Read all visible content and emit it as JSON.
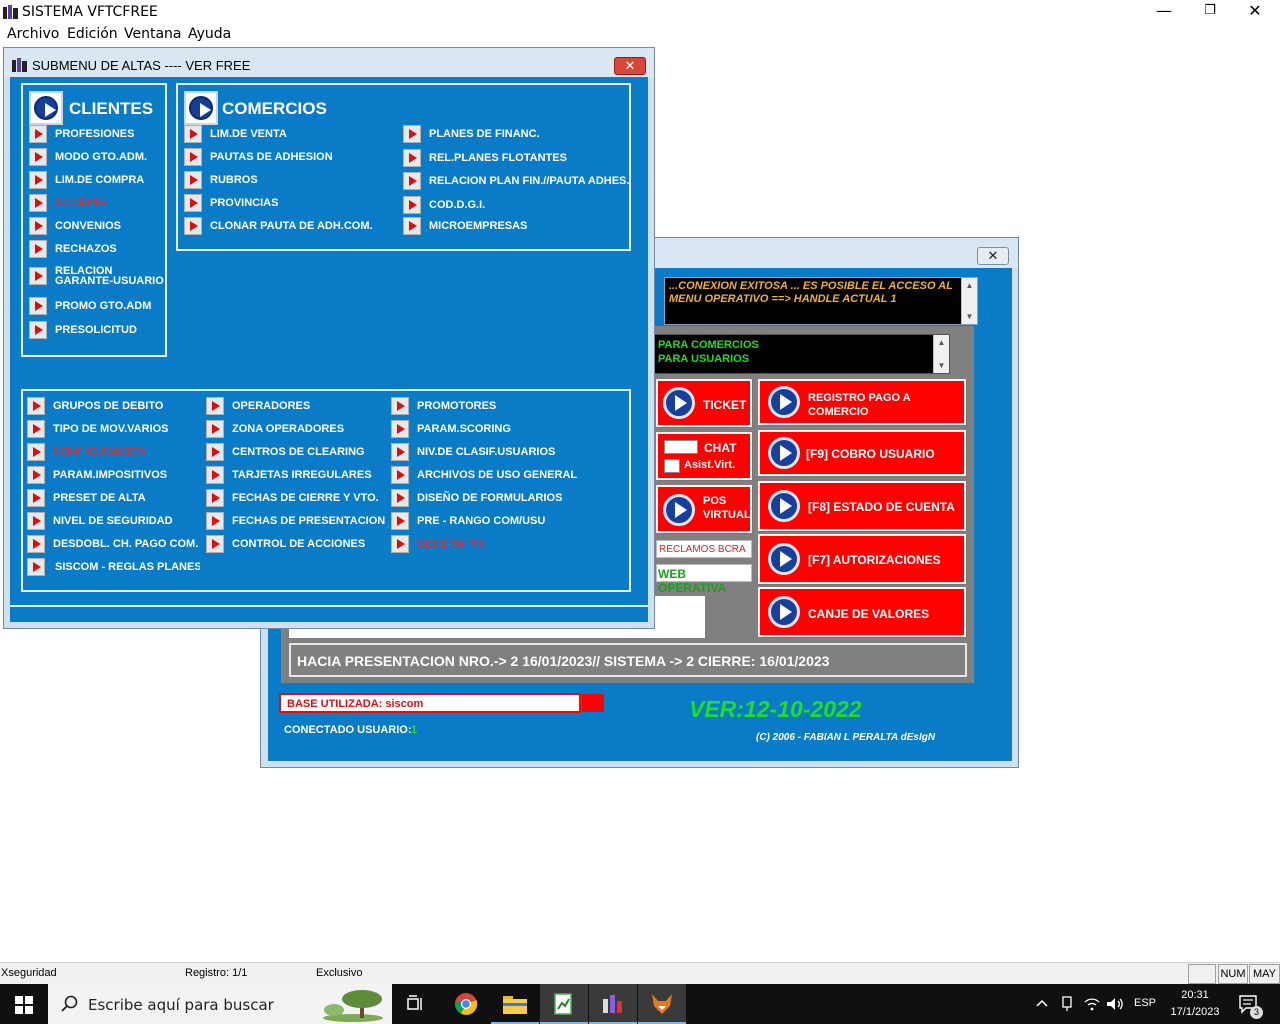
{
  "app": {
    "title": "SISTEMA VFTCFREE",
    "minimize": "—",
    "restore": "❐",
    "close": "✕"
  },
  "menubar": [
    "Archivo",
    "Edición",
    "Ventana",
    "Ayuda"
  ],
  "submenu_window": {
    "title": "SUBMENU DE ALTAS ---- VER FREE",
    "close": "✕",
    "clientes": {
      "title": "CLIENTES",
      "items": [
        {
          "label": "PROFESIONES",
          "highlight": false
        },
        {
          "label": "MODO GTO.ADM.",
          "highlight": false
        },
        {
          "label": "LIM.DE COMPRA",
          "highlight": false
        },
        {
          "label": "SCORING",
          "highlight": true
        },
        {
          "label": "CONVENIOS",
          "highlight": false
        },
        {
          "label": "RECHAZOS",
          "highlight": false
        },
        {
          "label": "RELACION",
          "highlight": false
        },
        {
          "label": "GARANTE-USUARIO",
          "highlight": false
        },
        {
          "label": "PROMO GTO.ADM",
          "highlight": false
        },
        {
          "label": "PRESOLICITUD",
          "highlight": false
        }
      ]
    },
    "comercios": {
      "title": "COMERCIOS",
      "col1": [
        "LIM.DE VENTA",
        "PAUTAS DE ADHESION",
        "RUBROS",
        "PROVINCIAS",
        "CLONAR PAUTA DE ADH.COM."
      ],
      "col2": [
        "PLANES DE FINANC.",
        "REL.PLANES FLOTANTES",
        "RELACION PLAN FIN.//PAUTA ADHES.",
        "COD.D.G.I.",
        "MICROEMPRESAS"
      ]
    },
    "general": {
      "col1": [
        {
          "label": "GRUPOS DE DEBITO",
          "highlight": false
        },
        {
          "label": "TIPO DE MOV.VARIOS",
          "highlight": false
        },
        {
          "label": "CONFIGURACION",
          "highlight": true
        },
        {
          "label": "PARAM.IMPOSITIVOS",
          "highlight": false
        },
        {
          "label": "PRESET DE ALTA",
          "highlight": false
        },
        {
          "label": "NIVEL DE SEGURIDAD",
          "highlight": false
        },
        {
          "label": "DESDOBL. CH. PAGO COM.",
          "highlight": false
        },
        {
          "label": "SISCOM  -  REGLAS PLANES",
          "highlight": false
        }
      ],
      "col2": [
        {
          "label": "OPERADORES",
          "highlight": false
        },
        {
          "label": "ZONA OPERADORES",
          "highlight": false
        },
        {
          "label": "CENTROS DE CLEARING",
          "highlight": false
        },
        {
          "label": "TARJETAS IRREGULARES",
          "highlight": false
        },
        {
          "label": "FECHAS DE CIERRE Y VTO.",
          "highlight": false
        },
        {
          "label": "FECHAS DE PRESENTACION",
          "highlight": false
        },
        {
          "label": "CONTROL DE ACCIONES",
          "highlight": false
        }
      ],
      "col3": [
        {
          "label": "PROMOTORES",
          "highlight": false
        },
        {
          "label": "PARAM.SCORING",
          "highlight": false
        },
        {
          "label": "NIV.DE CLASIF.USUARIOS",
          "highlight": false
        },
        {
          "label": "ARCHIVOS DE USO GENERAL",
          "highlight": false
        },
        {
          "label": "DISEÑO DE FORMULARIOS",
          "highlight": false
        },
        {
          "label": "PRE - RANGO COM/USU",
          "highlight": false
        },
        {
          "label": "GENERA PIN",
          "highlight": true
        }
      ]
    }
  },
  "main_window": {
    "close": "✕",
    "connection_msg_line1": "...CONEXION EXITOSA ... ES POSIBLE EL ACCESO AL",
    "connection_msg_line2": "MENU OPERATIVO  ==> HANDLE ACTUAL 1",
    "notice_line1": "PARA COMERCIOS",
    "notice_line2": "PARA USUARIOS",
    "ticket": "TICKET",
    "chat": "CHAT",
    "asist": "Asist.Virt.",
    "pos_line1": "POS",
    "pos_line2": "VIRTUAL",
    "reclamos": "RECLAMOS BCRA",
    "web_operativa": "WEB OPERATIVA",
    "registro_line1": "REGISTRO PAGO A",
    "registro_line2": "COMERCIO",
    "cobro": "[F9] COBRO USUARIO",
    "estado": "[F8] ESTADO DE CUENTA",
    "autorizaciones": "[F7] AUTORIZACIONES",
    "canje": "CANJE DE VALORES",
    "presentacion": "HACIA PRESENTACION NRO.-> 2 16/01/2023// SISTEMA ->  2 CIERRE: 16/01/2023",
    "base_utilizada": "BASE UTILIZADA: siscom",
    "conectado_label": "CONECTADO USUARIO:",
    "conectado_value": "1",
    "version": "VER:12-10-2022",
    "copyright": "(C)  2006 - FABIAN L PERALTA dEsIgN"
  },
  "statusbar": {
    "user": "Xseguridad",
    "registro": "Registro: 1/1",
    "modo": "Exclusivo",
    "num": "NUM",
    "may": "MAY"
  },
  "taskbar": {
    "search_placeholder": "Escribe aquí para buscar",
    "lang": "ESP",
    "time": "20:31",
    "date": "17/1/2023",
    "notif_count": "3"
  },
  "colors": {
    "panel_blue": "#0a7cc7",
    "button_red": "#ff0000",
    "version_green": "#22dd22",
    "highlight_red": "#ff2020"
  }
}
